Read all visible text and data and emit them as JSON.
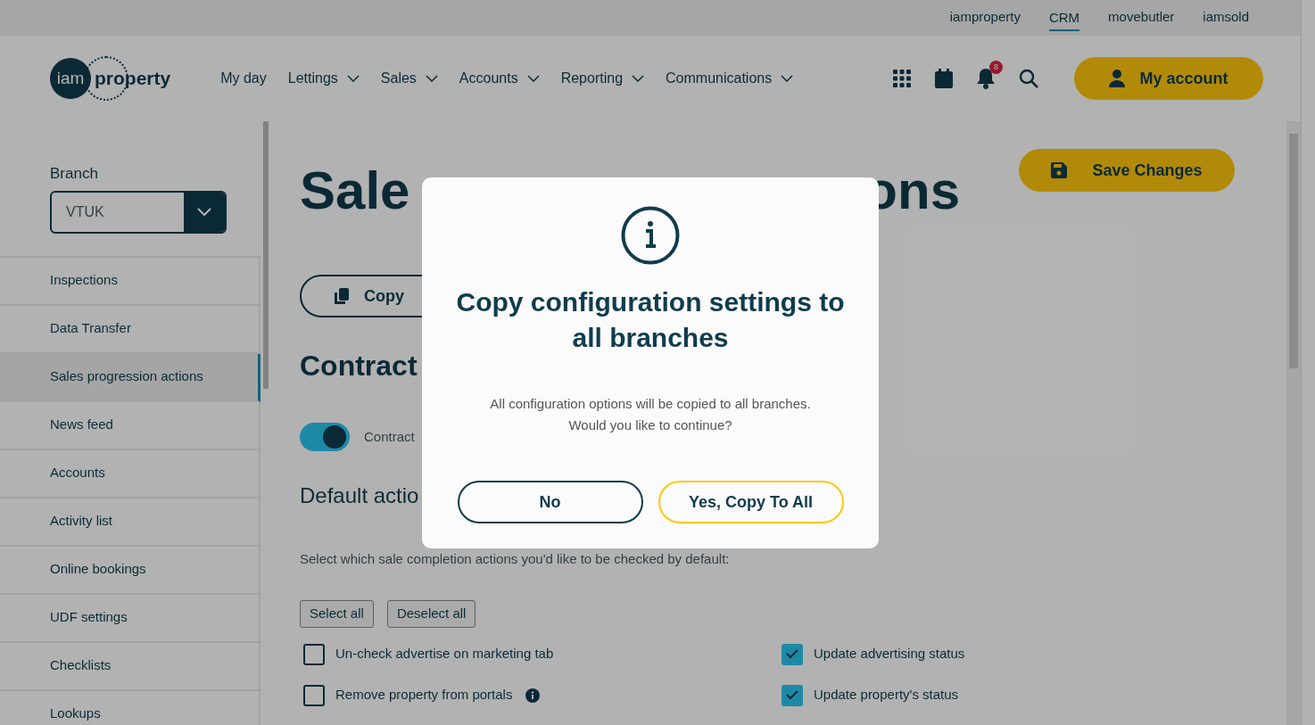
{
  "top_links": [
    {
      "label": "iamproperty",
      "selected": false
    },
    {
      "label": "CRM",
      "selected": true
    },
    {
      "label": "movebutler",
      "selected": false
    },
    {
      "label": "iamsold",
      "selected": false
    }
  ],
  "logo": {
    "prefix": "iam",
    "suffix": "property"
  },
  "nav": [
    {
      "label": "My day",
      "dropdown": false
    },
    {
      "label": "Lettings",
      "dropdown": true
    },
    {
      "label": "Sales",
      "dropdown": true
    },
    {
      "label": "Accounts",
      "dropdown": true
    },
    {
      "label": "Reporting",
      "dropdown": true
    },
    {
      "label": "Communications",
      "dropdown": true
    }
  ],
  "notification_count": "8",
  "account_button": "My account",
  "sidebar": {
    "branch_label": "Branch",
    "branch_value": "VTUK",
    "items": [
      {
        "label": "Inspections",
        "selected": false
      },
      {
        "label": "Data Transfer",
        "selected": false
      },
      {
        "label": "Sales progression actions",
        "selected": true
      },
      {
        "label": "News feed",
        "selected": false
      },
      {
        "label": "Accounts",
        "selected": false
      },
      {
        "label": "Activity list",
        "selected": false
      },
      {
        "label": "Online bookings",
        "selected": false
      },
      {
        "label": "UDF settings",
        "selected": false
      },
      {
        "label": "Checklists",
        "selected": false
      },
      {
        "label": "Lookups",
        "selected": false
      }
    ]
  },
  "main": {
    "title_parts": [
      "Sale",
      "ons"
    ],
    "save_button": "Save Changes",
    "copy_button": "Copy",
    "section_heading": "Contract",
    "toggle": {
      "label": "Contract",
      "on": true
    },
    "subheading": "Default actio",
    "instruction": "Select which sale completion actions you'd like to be checked by default:",
    "select_all": "Select all",
    "deselect_all": "Deselect all",
    "actions": [
      {
        "label": "Un-check advertise on marketing tab",
        "checked": false,
        "info": false
      },
      {
        "label": "Update advertising status",
        "checked": true,
        "info": false
      },
      {
        "label": "Remove property from portals",
        "checked": false,
        "info": true
      },
      {
        "label": "Update property's status",
        "checked": true,
        "info": false
      }
    ]
  },
  "modal": {
    "title": "Copy configuration settings to all branches",
    "message_lines": [
      "All configuration options will be copied to all branches.",
      "Would you like to continue?"
    ],
    "buttons": [
      {
        "label": "No",
        "kind": "secondary"
      },
      {
        "label": "Yes, Copy To All",
        "kind": "primary"
      }
    ]
  }
}
